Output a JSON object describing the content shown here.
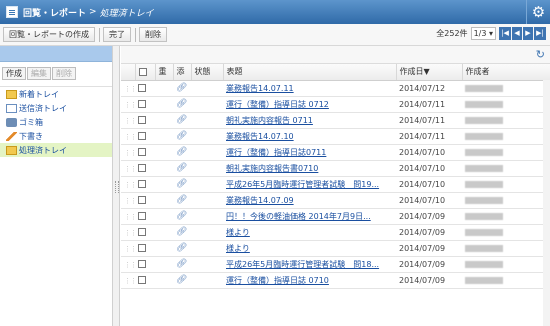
{
  "title": {
    "crumb1": "回覧・レポート",
    "sep": ">",
    "crumb2": "処理済トレイ"
  },
  "toolbar": {
    "create_label": "回覧・レポートの作成",
    "complete_label": "完了",
    "delete_label": "削除"
  },
  "pager": {
    "total": "全252件",
    "page": "1/3"
  },
  "folder_buttons": {
    "create": "作成",
    "edit": "編集",
    "delete": "削除"
  },
  "folders": [
    {
      "label": "新着トレイ",
      "icon": "inbox-icon"
    },
    {
      "label": "送信済トレイ",
      "icon": "sent-icon"
    },
    {
      "label": "ゴミ箱",
      "icon": "trash-icon"
    },
    {
      "label": "下書き",
      "icon": "pencil-icon"
    },
    {
      "label": "処理済トレイ",
      "icon": "folder-icon"
    }
  ],
  "columns": {
    "important": "重",
    "attach": "添",
    "status": "状態",
    "subject": "表題",
    "date": "作成日▼",
    "author": "作成者"
  },
  "rows": [
    {
      "subject": "業務報告14.07.11",
      "date": "2014/07/12"
    },
    {
      "subject": "運行（整備）指導日誌 0712",
      "date": "2014/07/11"
    },
    {
      "subject": "朝礼実施内容報告 0711",
      "date": "2014/07/11"
    },
    {
      "subject": "業務報告14.07.10",
      "date": "2014/07/11"
    },
    {
      "subject": "運行（整備）指導日誌0711",
      "date": "2014/07/10"
    },
    {
      "subject": "朝礼実施内容報告書0710",
      "date": "2014/07/10"
    },
    {
      "subject": "平成26年5月臨時運行管理者試験　問19...",
      "date": "2014/07/10"
    },
    {
      "subject": "業務報告14.07.09",
      "date": "2014/07/10"
    },
    {
      "subject": "円！！今後の軽油価格 2014年7月9日...",
      "date": "2014/07/09"
    },
    {
      "subject": "様より",
      "date": "2014/07/09"
    },
    {
      "subject": "様より",
      "date": "2014/07/09"
    },
    {
      "subject": "平成26年5月臨時運行管理者試験　問18...",
      "date": "2014/07/09"
    },
    {
      "subject": "運行（整備）指導日誌 0710",
      "date": "2014/07/09"
    }
  ]
}
